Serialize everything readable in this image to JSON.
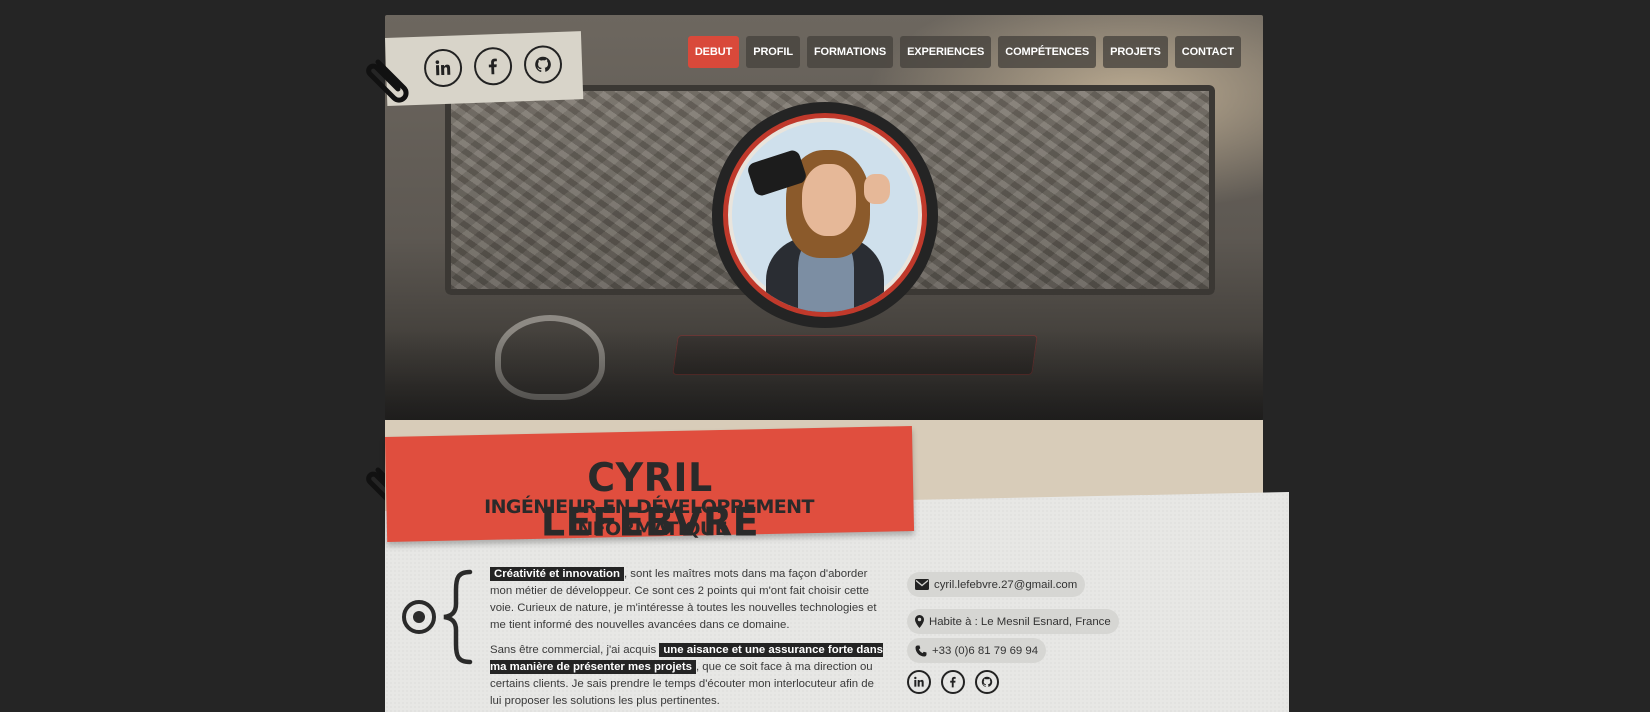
{
  "nav": {
    "items": [
      "DEBUT",
      "PROFIL",
      "FORMATIONS",
      "EXPERIENCES",
      "COMPÉTENCES",
      "PROJETS",
      "CONTACT"
    ],
    "active": "DEBUT"
  },
  "social": {
    "icons": [
      "linkedin-icon",
      "facebook-icon",
      "github-icon"
    ]
  },
  "profile": {
    "name": "CYRIL LEFEBVRE",
    "title": "INGÉNIEUR EN DÉVELOPPEMENT INFORMATIQUE"
  },
  "bio": {
    "p1_highlight": "Créativité et innovation",
    "p1_text": ", sont les maîtres mots dans ma façon d'aborder mon métier de développeur. Ce sont ces 2 points qui m'ont fait choisir cette voie. Curieux de nature, je m'intéresse à toutes les nouvelles technologies et me tient informé des nouvelles avancées dans ce domaine.",
    "p2_before": "Sans être commercial, j'ai acquis ",
    "p2_highlight": "une aisance et une assurance forte dans ma manière de présenter mes projets",
    "p2_after": ", que ce soit face à ma direction ou certains clients. Je sais prendre le temps d'écouter mon interlocuteur afin de lui proposer les solutions les plus pertinentes."
  },
  "contact": {
    "email": "cyril.lefebvre.27@gmail.com",
    "location": "Habite à : Le Mesnil Esnard, France",
    "phone": "+33 (0)6 81 79 69 94"
  },
  "colors": {
    "accent_red": "#e04e3e",
    "nav_active": "#d9493a",
    "background": "#252525",
    "paper": "#e7e7e5",
    "beige": "#d8ccb9"
  }
}
